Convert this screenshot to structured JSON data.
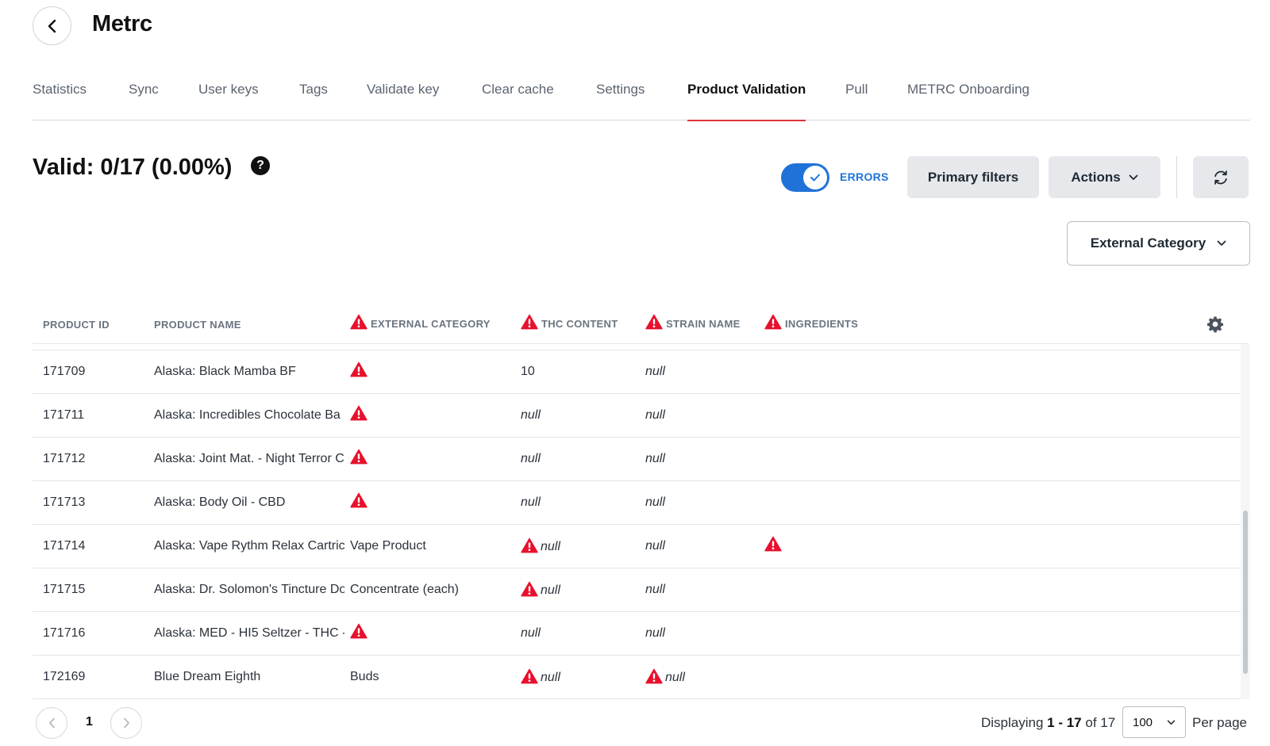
{
  "header": {
    "title": "Metrc",
    "back_icon": "chevron-left-icon"
  },
  "tabs": [
    {
      "label": "Statistics"
    },
    {
      "label": "Sync"
    },
    {
      "label": "User keys"
    },
    {
      "label": "Tags"
    },
    {
      "label": "Validate key"
    },
    {
      "label": "Clear cache"
    },
    {
      "label": "Settings"
    },
    {
      "label": "Product Validation",
      "active": true
    },
    {
      "label": "Pull"
    },
    {
      "label": "METRC Onboarding"
    }
  ],
  "validation": {
    "summary": "Valid: 0/17 (0.00%)",
    "help_glyph": "?"
  },
  "toolbar": {
    "errors_toggle_label": "ERRORS",
    "errors_toggle_on": true,
    "primary_filters_label": "Primary filters",
    "actions_label": "Actions",
    "external_category_label": "External Category"
  },
  "table": {
    "columns": {
      "product_id": "PRODUCT ID",
      "product_name": "PRODUCT NAME",
      "external_category": "EXTERNAL CATEGORY",
      "thc_content": "THC CONTENT",
      "strain_name": "STRAIN NAME",
      "ingredients": "INGREDIENTS"
    },
    "rows": [
      {
        "id": "171709",
        "name": "Alaska: Black Mamba BF",
        "category": "",
        "category_error": true,
        "thc": "10",
        "thc_error": false,
        "strain": "null",
        "strain_error": false,
        "ingredients_error": false
      },
      {
        "id": "171711",
        "name": "Alaska: Incredibles Chocolate Ba",
        "category": "",
        "category_error": true,
        "thc": "null",
        "thc_error": false,
        "strain": "null",
        "strain_error": false,
        "ingredients_error": false
      },
      {
        "id": "171712",
        "name": "Alaska: Joint Mat. - Night Terror C",
        "category": "",
        "category_error": true,
        "thc": "null",
        "thc_error": false,
        "strain": "null",
        "strain_error": false,
        "ingredients_error": false
      },
      {
        "id": "171713",
        "name": "Alaska: Body Oil - CBD",
        "category": "",
        "category_error": true,
        "thc": "null",
        "thc_error": false,
        "strain": "null",
        "strain_error": false,
        "ingredients_error": false
      },
      {
        "id": "171714",
        "name": "Alaska: Vape Rythm Relax Cartric",
        "category": "Vape Product",
        "category_error": false,
        "thc": "null",
        "thc_error": true,
        "strain": "null",
        "strain_error": false,
        "ingredients_error": true
      },
      {
        "id": "171715",
        "name": "Alaska: Dr. Solomon's Tincture Do",
        "category": "Concentrate (each)",
        "category_error": false,
        "thc": "null",
        "thc_error": true,
        "strain": "null",
        "strain_error": false,
        "ingredients_error": false
      },
      {
        "id": "171716",
        "name": "Alaska: MED - HI5 Seltzer - THC -",
        "category": "",
        "category_error": true,
        "thc": "null",
        "thc_error": false,
        "strain": "null",
        "strain_error": false,
        "ingredients_error": false
      },
      {
        "id": "172169",
        "name": "Blue Dream Eighth",
        "category": "Buds",
        "category_error": false,
        "thc": "null",
        "thc_error": true,
        "strain": "null",
        "strain_error": true,
        "ingredients_error": false
      }
    ]
  },
  "pagination": {
    "current_page": "1",
    "displaying_prefix": "Displaying ",
    "displaying_range": "1 - 17",
    "displaying_suffix": " of 17",
    "per_page_value": "100",
    "per_page_label": "Per page"
  },
  "colors": {
    "accent": "#1f73d8",
    "error": "#e8112d",
    "tab_underline": "#e0333b"
  }
}
